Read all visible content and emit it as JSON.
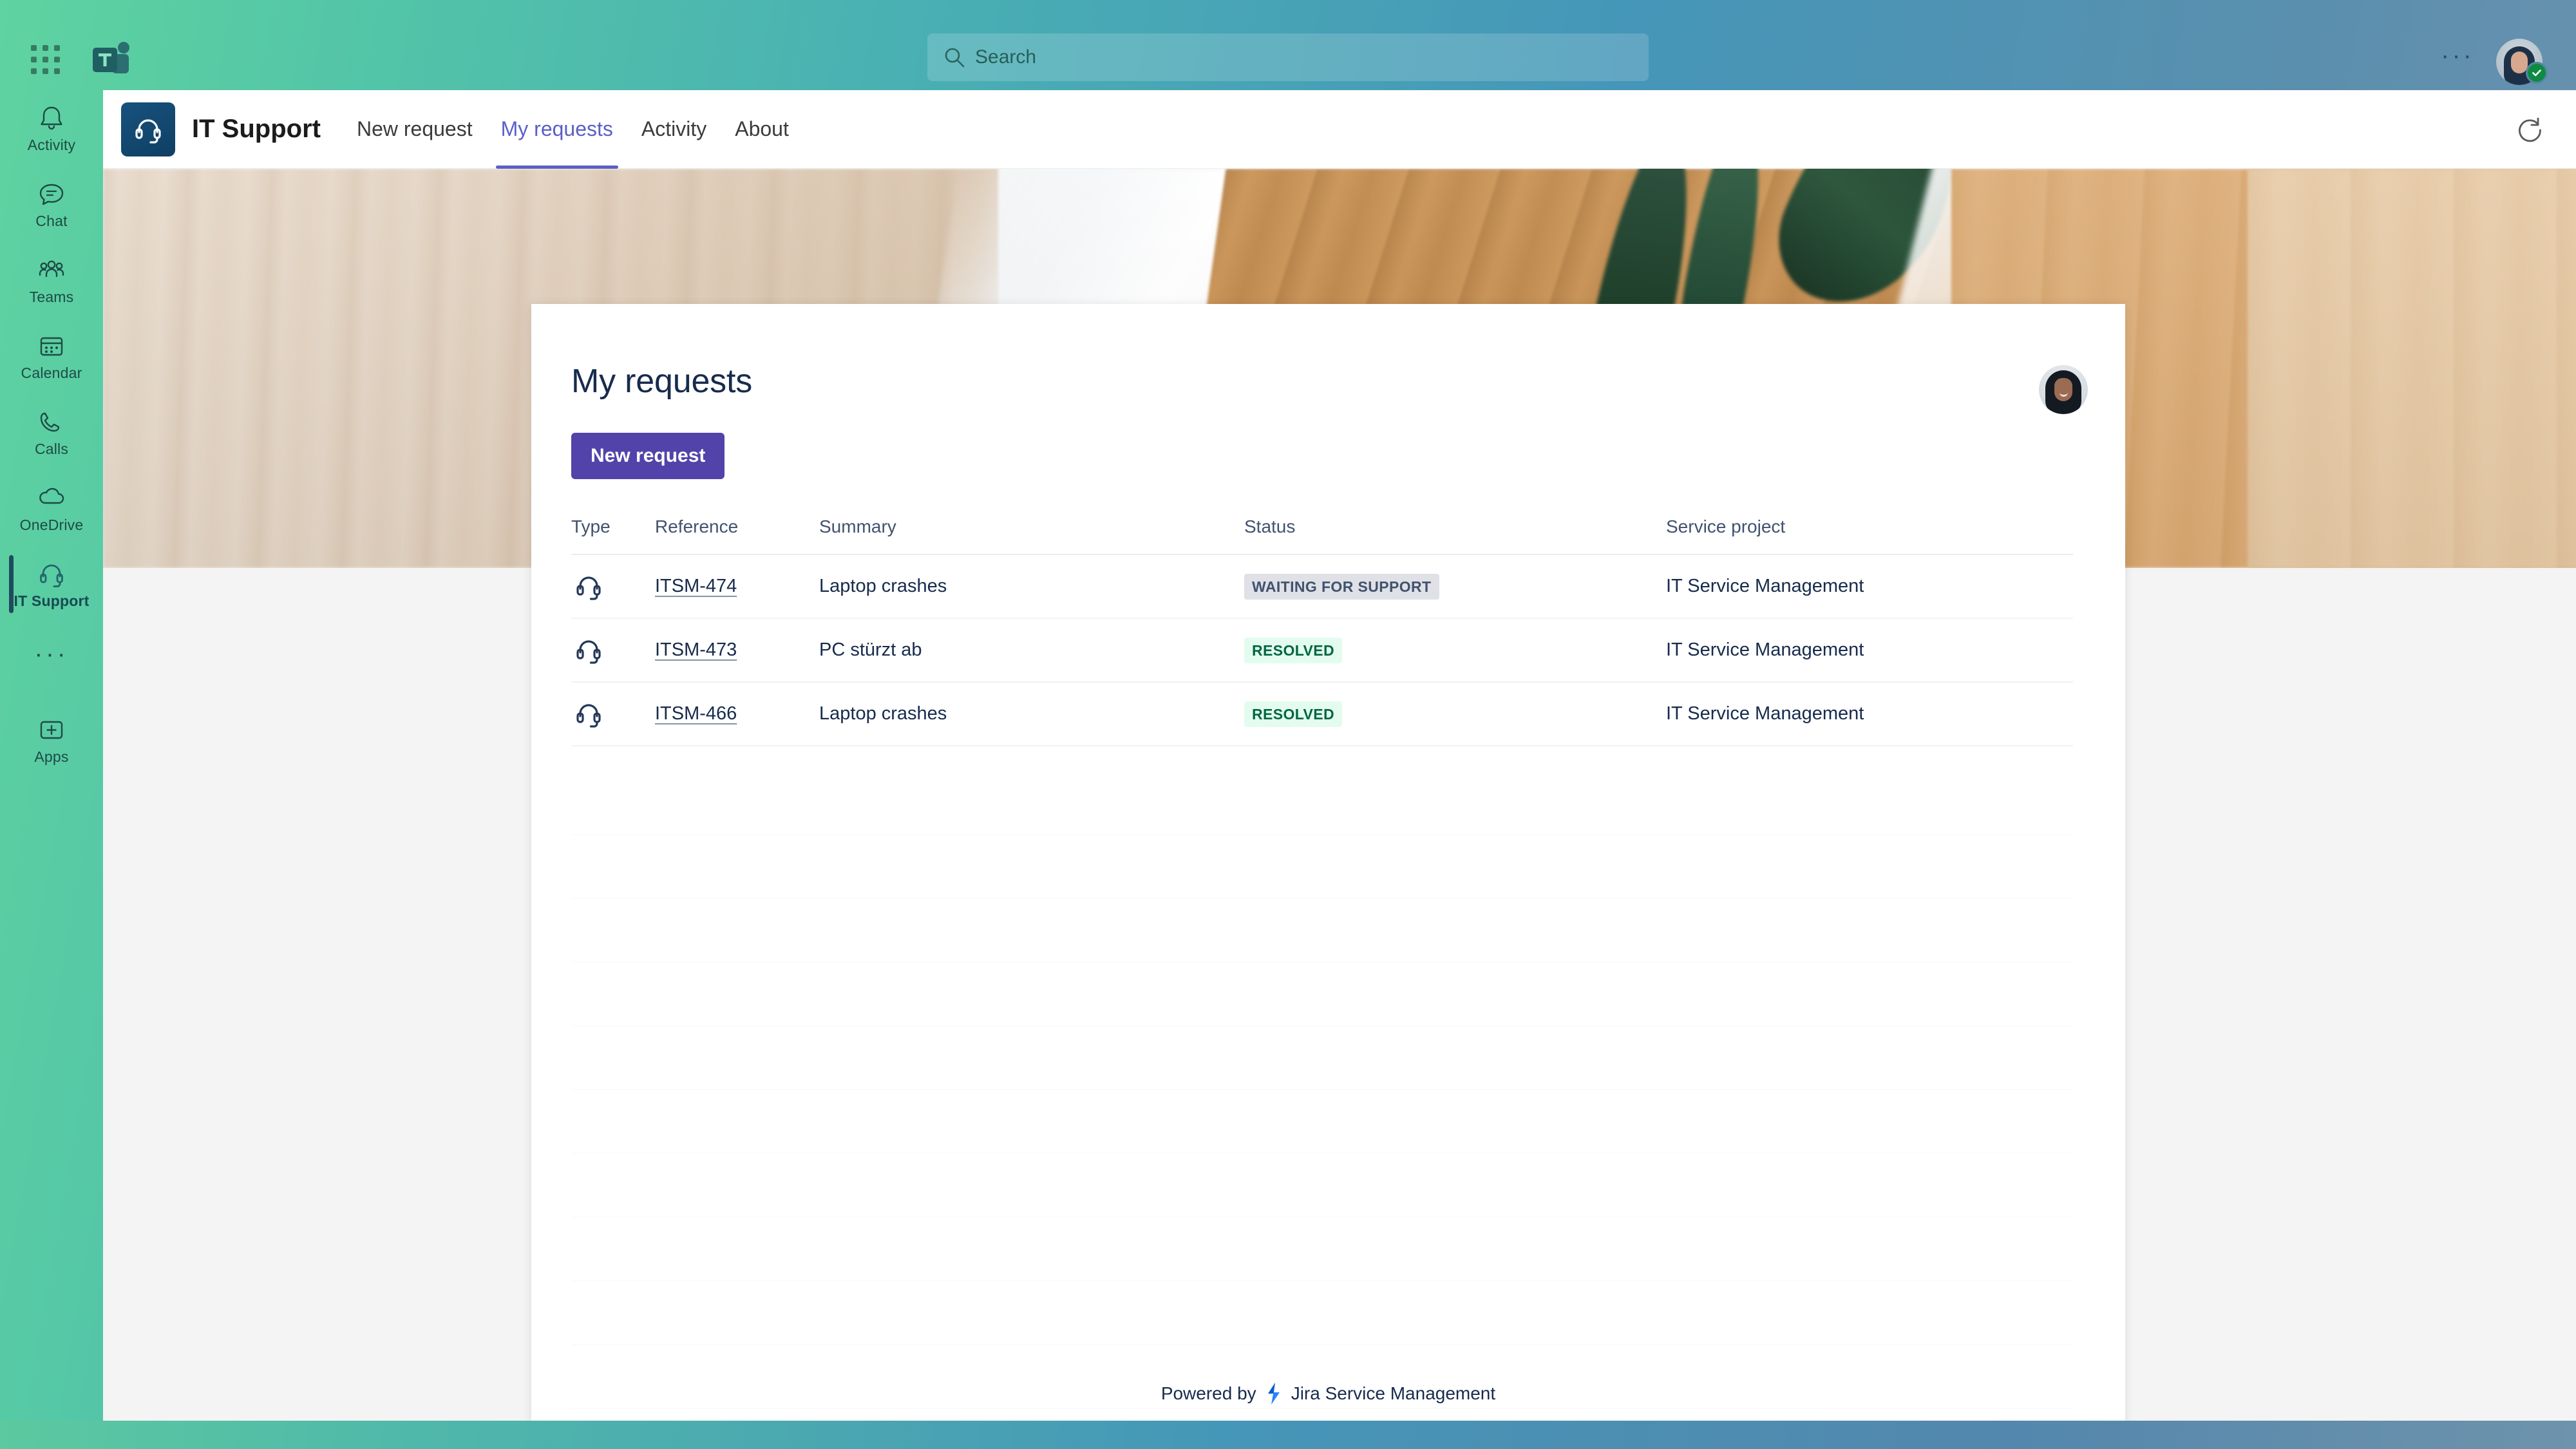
{
  "shell": {
    "waffle_icon": "app-launcher-icon",
    "teams_logo_icon": "microsoft-teams-logo",
    "search": {
      "placeholder": "Search",
      "value": "",
      "icon": "search-icon"
    },
    "more_options_label": "···",
    "avatar_name": "user-avatar",
    "presence_status": "available",
    "rail": [
      {
        "label": "Activity",
        "icon": "bell-icon",
        "active": false
      },
      {
        "label": "Chat",
        "icon": "chat-icon",
        "active": false
      },
      {
        "label": "Teams",
        "icon": "people-icon",
        "active": false
      },
      {
        "label": "Calendar",
        "icon": "calendar-icon",
        "active": false
      },
      {
        "label": "Calls",
        "icon": "phone-icon",
        "active": false
      },
      {
        "label": "OneDrive",
        "icon": "cloud-icon",
        "active": false
      },
      {
        "label": "IT Support",
        "icon": "headset-icon",
        "active": true
      }
    ],
    "rail_more_label": "···",
    "apps": {
      "label": "Apps",
      "icon": "apps-plus-icon"
    }
  },
  "app": {
    "logo_icon": "headset-logo-icon",
    "name": "IT Support",
    "tabs": [
      {
        "label": "New request",
        "active": false
      },
      {
        "label": "My requests",
        "active": true
      },
      {
        "label": "Activity",
        "active": false
      },
      {
        "label": "About",
        "active": false
      }
    ],
    "refresh_icon": "refresh-icon"
  },
  "card": {
    "title": "My requests",
    "new_request_label": "New request",
    "avatar_name": "reporter-avatar",
    "table": {
      "columns": [
        "Type",
        "Reference",
        "Summary",
        "Status",
        "Service project"
      ],
      "rows": [
        {
          "type_icon": "headset-icon",
          "reference": "ITSM-474",
          "summary": "Laptop crashes",
          "status": "WAITING FOR SUPPORT",
          "status_kind": "waiting",
          "service_project": "IT Service Management"
        },
        {
          "type_icon": "headset-icon",
          "reference": "ITSM-473",
          "summary": "PC stürzt ab",
          "status": "RESOLVED",
          "status_kind": "resolved",
          "service_project": "IT Service Management"
        },
        {
          "type_icon": "headset-icon",
          "reference": "ITSM-466",
          "summary": "Laptop crashes",
          "status": "RESOLVED",
          "status_kind": "resolved",
          "service_project": "IT Service Management"
        }
      ]
    },
    "footer": {
      "powered_by": "Powered by",
      "product": "Jira Service Management",
      "logo_icon": "jira-service-management-icon"
    }
  },
  "colors": {
    "teams_accent": "#5b5fc7",
    "jira_primary": "#5243aa",
    "status_resolved_bg": "#e3fcef",
    "status_resolved_fg": "#006644",
    "status_waiting_bg": "#dfe1e6",
    "status_waiting_fg": "#42526e",
    "text_primary": "#172b4d",
    "text_subtle": "#42526e",
    "presence_green": "#0e8a43",
    "app_logo_blue": "#17527e"
  }
}
